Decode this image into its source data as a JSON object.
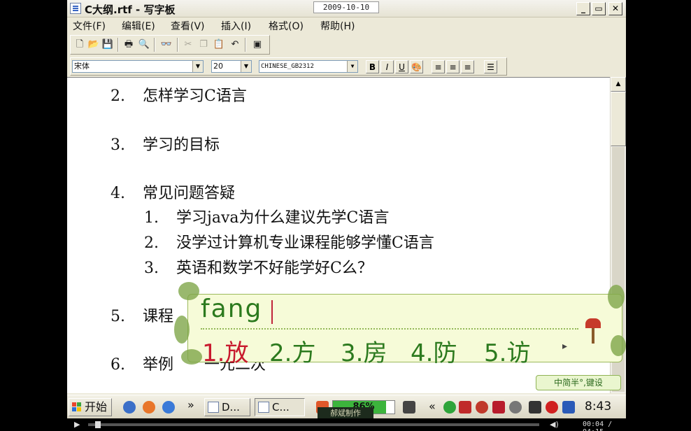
{
  "window": {
    "title": "C大纲.rtf - 写字板",
    "date": "2009-10-10",
    "minimize": "_",
    "maximize": "▭",
    "close": "✕"
  },
  "menu": [
    "文件(F)",
    "编辑(E)",
    "查看(V)",
    "插入(I)",
    "格式(O)",
    "帮助(H)"
  ],
  "format_bar": {
    "font": "宋体",
    "size": "20",
    "script": "CHINESE_GB2312",
    "bold": "B",
    "italic": "I",
    "underline": "U"
  },
  "document": {
    "lines": [
      {
        "num": "2.",
        "text": "怎样学习C语言"
      },
      {
        "num": "3.",
        "text": "学习的目标"
      },
      {
        "num": "4.",
        "text": "常见问题答疑"
      },
      {
        "num": "1.",
        "text": "学习java为什么建议先学C语言"
      },
      {
        "num": "2.",
        "text": "没学过计算机专业课程能够学懂C语言"
      },
      {
        "num": "3.",
        "text": "英语和数学不好能学好C么？"
      },
      {
        "num": "5.",
        "text": "课程"
      },
      {
        "num": "6.",
        "text": "举例"
      }
    ],
    "partial_line_6_tail": "一元二次"
  },
  "ime": {
    "composition": "fang",
    "candidates": [
      "1.放",
      "2.方",
      "3.房",
      "4.防",
      "5.访"
    ],
    "status": "中简半°,键设"
  },
  "taskbar": {
    "start_label": "开始",
    "tasks": [
      "D...",
      "C..."
    ],
    "progress_percent": 86,
    "progress_text": "86%",
    "tray_label": "郝斌制作",
    "clock": "8:43"
  },
  "player": {
    "play": "▶",
    "volume": "◀)",
    "time": "00:04 / 04:15",
    "progress_fraction": 0.016
  },
  "colors": {
    "ime_text": "#2c7a1e",
    "ime_selected": "#c81a2e",
    "progress_fill": "#3cb43c"
  }
}
